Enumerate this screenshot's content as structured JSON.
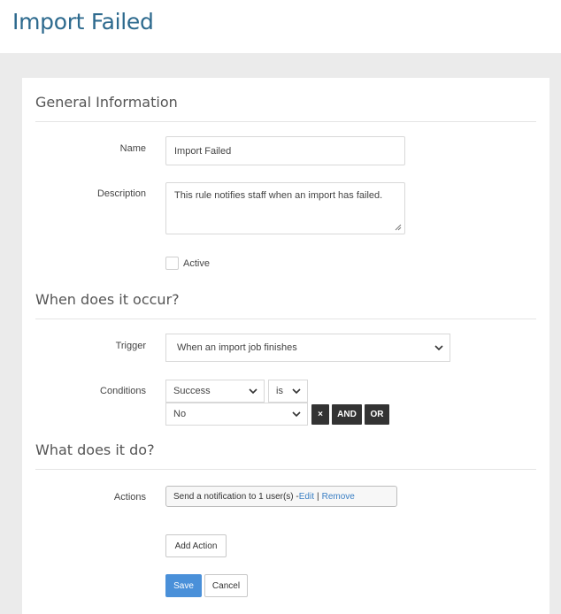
{
  "page": {
    "title": "Import Failed"
  },
  "general": {
    "heading": "General Information",
    "name_label": "Name",
    "name_value": "Import Failed",
    "description_label": "Description",
    "description_value": "This rule notifies staff when an import has failed.",
    "active_label": "Active",
    "active_checked": false
  },
  "occurrence": {
    "heading": "When does it occur?",
    "trigger_label": "Trigger",
    "trigger_value": "When an import job finishes",
    "conditions_label": "Conditions",
    "condition_field": "Success",
    "condition_operator": "is",
    "condition_value": "No",
    "remove_label": "×",
    "and_label": "AND",
    "or_label": "OR"
  },
  "actions": {
    "heading": "What does it do?",
    "actions_label": "Actions",
    "action_text": "Send a notification to 1 user(s) - ",
    "edit_label": "Edit",
    "separator": "|",
    "remove_label": "Remove",
    "add_action_label": "Add Action"
  },
  "footer": {
    "save_label": "Save",
    "cancel_label": "Cancel"
  },
  "colors": {
    "title": "#2d6a8e",
    "primary": "#4a90d9",
    "dark_button": "#333333",
    "link": "#3a7fc4",
    "background": "#ebebeb"
  }
}
